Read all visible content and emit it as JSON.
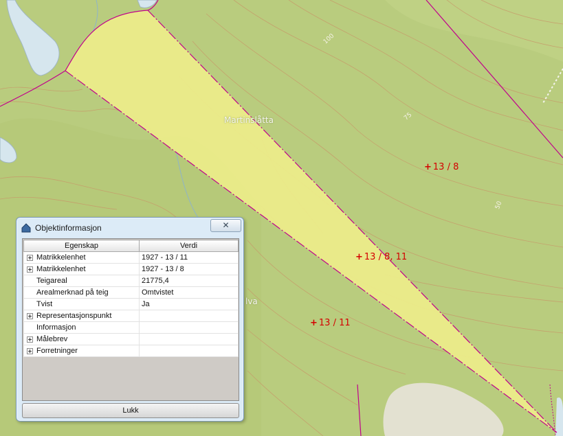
{
  "map": {
    "place_label": "Martinslåtta",
    "partial_label": "lva",
    "contour_labels": [
      "100",
      "75",
      "50"
    ],
    "parcel_labels": [
      "13 / 8",
      "13 / 8, 11",
      "13 / 11"
    ],
    "parcel_marker": "+",
    "colors": {
      "terrain": "#b9cc7e",
      "parcel_fill": "#eded8a",
      "boundary": "#c0008c",
      "contour": "#c79a6a",
      "water": "#d6e6ee",
      "parcel_label": "#d40000"
    }
  },
  "dialog": {
    "title": "Objektinformasjon",
    "title_icon": "house-icon",
    "close_icon": "close-icon",
    "close_glyph": "✕",
    "columns": [
      "Egenskap",
      "Verdi"
    ],
    "rows": [
      {
        "expandable": true,
        "property": "Matrikkelenhet",
        "value": "1927 - 13 / 11"
      },
      {
        "expandable": true,
        "property": "Matrikkelenhet",
        "value": "1927 - 13 / 8"
      },
      {
        "expandable": false,
        "property": "Teigareal",
        "value": "21775,4"
      },
      {
        "expandable": false,
        "property": "Arealmerknad på teig",
        "value": "Omtvistet"
      },
      {
        "expandable": false,
        "property": "Tvist",
        "value": "Ja"
      },
      {
        "expandable": true,
        "property": "Representasjonspunkt",
        "value": ""
      },
      {
        "expandable": false,
        "property": "Informasjon",
        "value": ""
      },
      {
        "expandable": true,
        "property": "Målebrev",
        "value": ""
      },
      {
        "expandable": true,
        "property": "Forretninger",
        "value": ""
      }
    ],
    "close_button_label": "Lukk"
  }
}
